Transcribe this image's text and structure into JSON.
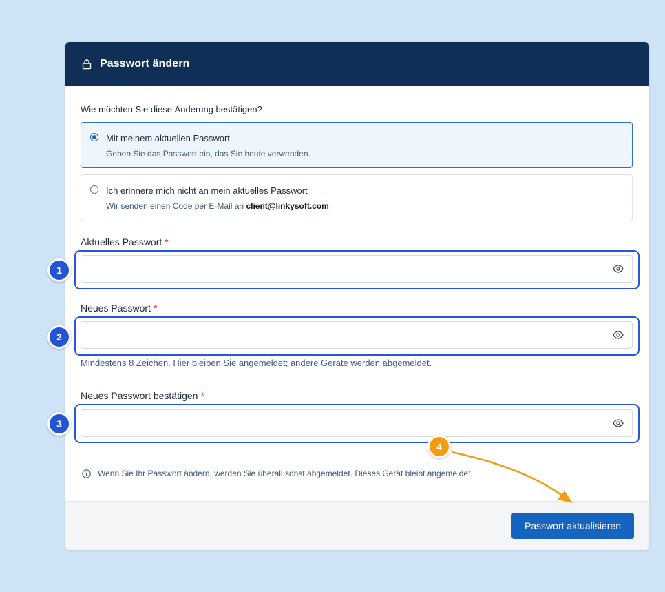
{
  "header": {
    "title": "Passwort ändern",
    "icon": "lock-icon"
  },
  "form": {
    "question": "Wie möchten Sie diese Änderung bestätigen?",
    "options": [
      {
        "title": "Mit meinem aktuellen Passwort",
        "description": "Geben Sie das Passwort ein, das Sie heute verwenden.",
        "selected": true
      },
      {
        "title": "Ich erinnere mich nicht an mein aktuelles Passwort",
        "description_prefix": "Wir senden einen Code per E-Mail an",
        "email": "client@linkysoft.com",
        "selected": false
      }
    ],
    "fields": [
      {
        "label": "Aktuelles Passwort",
        "required_mark": "*",
        "value": ""
      },
      {
        "label": "Neues Passwort",
        "required_mark": "*",
        "value": ""
      },
      {
        "label": "Neues Passwort bestätigen",
        "required_mark": "*",
        "value": ""
      }
    ],
    "hint": "Mindestens 8 Zeichen. Hier bleiben Sie angemeldet; andere Geräte werden abgemeldet.",
    "info": "Wenn Sie Ihr Passwort ändern, werden Sie überall sonst abgemeldet. Dieses Gerät bleibt angemeldet."
  },
  "footer": {
    "submit_label": "Passwort aktualisieren"
  },
  "annotations": {
    "badges": [
      "1",
      "2",
      "3",
      "4"
    ]
  },
  "colors": {
    "header_bg": "#0f2f57",
    "primary": "#1565c0",
    "annotation_blue": "#2553d6",
    "annotation_orange": "#f29c11",
    "page_bg": "#cfe3f7"
  }
}
